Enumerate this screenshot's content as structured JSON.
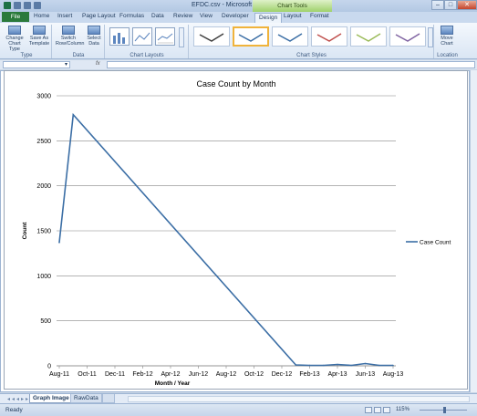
{
  "window": {
    "title": "EFDC.csv - Microsoft Excel",
    "context_tab_group": "Chart Tools",
    "minimize": "–",
    "maximize": "□",
    "close": "✕"
  },
  "ribbon_tabs": [
    "File",
    "Home",
    "Insert",
    "Page Layout",
    "Formulas",
    "Data",
    "Review",
    "View",
    "Developer",
    "Design",
    "Layout",
    "Format"
  ],
  "active_tab": "Design",
  "ribbon": {
    "type_group": {
      "label": "Type",
      "change_chart_type": "Change Chart Type",
      "save_as_template": "Save As Template"
    },
    "data_group": {
      "label": "Data",
      "switch_row_column": "Switch Row/Column",
      "select_data": "Select Data"
    },
    "chart_layouts_label": "Chart Layouts",
    "chart_styles_label": "Chart Styles",
    "location_group": {
      "label": "Location",
      "move_chart": "Move Chart"
    },
    "style_colors": [
      "#404040",
      "#3b6ea5",
      "#3b6ea5",
      "#c0504d",
      "#9bbb59",
      "#8064a2"
    ]
  },
  "formula_bar": {
    "fx_label": "fx",
    "name_box_dropdown": "▾"
  },
  "chart_data": {
    "type": "line",
    "title": "Case Count by Month",
    "xlabel": "Month / Year",
    "ylabel": "Count",
    "ylim": [
      0,
      3000
    ],
    "y_ticks": [
      "0",
      "500",
      "1000",
      "1500",
      "2000",
      "2500",
      "3000"
    ],
    "x_tick_labels": [
      "Aug-11",
      "Oct-11",
      "Dec-11",
      "Feb-12",
      "Apr-12",
      "Jun-12",
      "Aug-12",
      "Oct-12",
      "Dec-12",
      "Feb-13",
      "Apr-13",
      "Jun-13",
      "Aug-13"
    ],
    "grid": true,
    "legend_position": "right",
    "series": [
      {
        "name": "Case Count",
        "color": "#3b6ea5",
        "points": [
          {
            "x": "Aug-11",
            "y": 1370
          },
          {
            "x": "Sep-11",
            "y": 2790
          },
          {
            "x": "Jan-13",
            "y": 10
          },
          {
            "x": "Feb-13",
            "y": 5
          },
          {
            "x": "Mar-13",
            "y": 5
          },
          {
            "x": "Apr-13",
            "y": 15
          },
          {
            "x": "May-13",
            "y": 5
          },
          {
            "x": "Jun-13",
            "y": 25
          },
          {
            "x": "Jul-13",
            "y": 5
          },
          {
            "x": "Aug-13",
            "y": 5
          }
        ]
      }
    ]
  },
  "sheet_tabs": [
    "Graph Image",
    "RawData"
  ],
  "active_sheet": "Graph Image",
  "status": {
    "ready": "Ready",
    "zoom": "115%"
  }
}
